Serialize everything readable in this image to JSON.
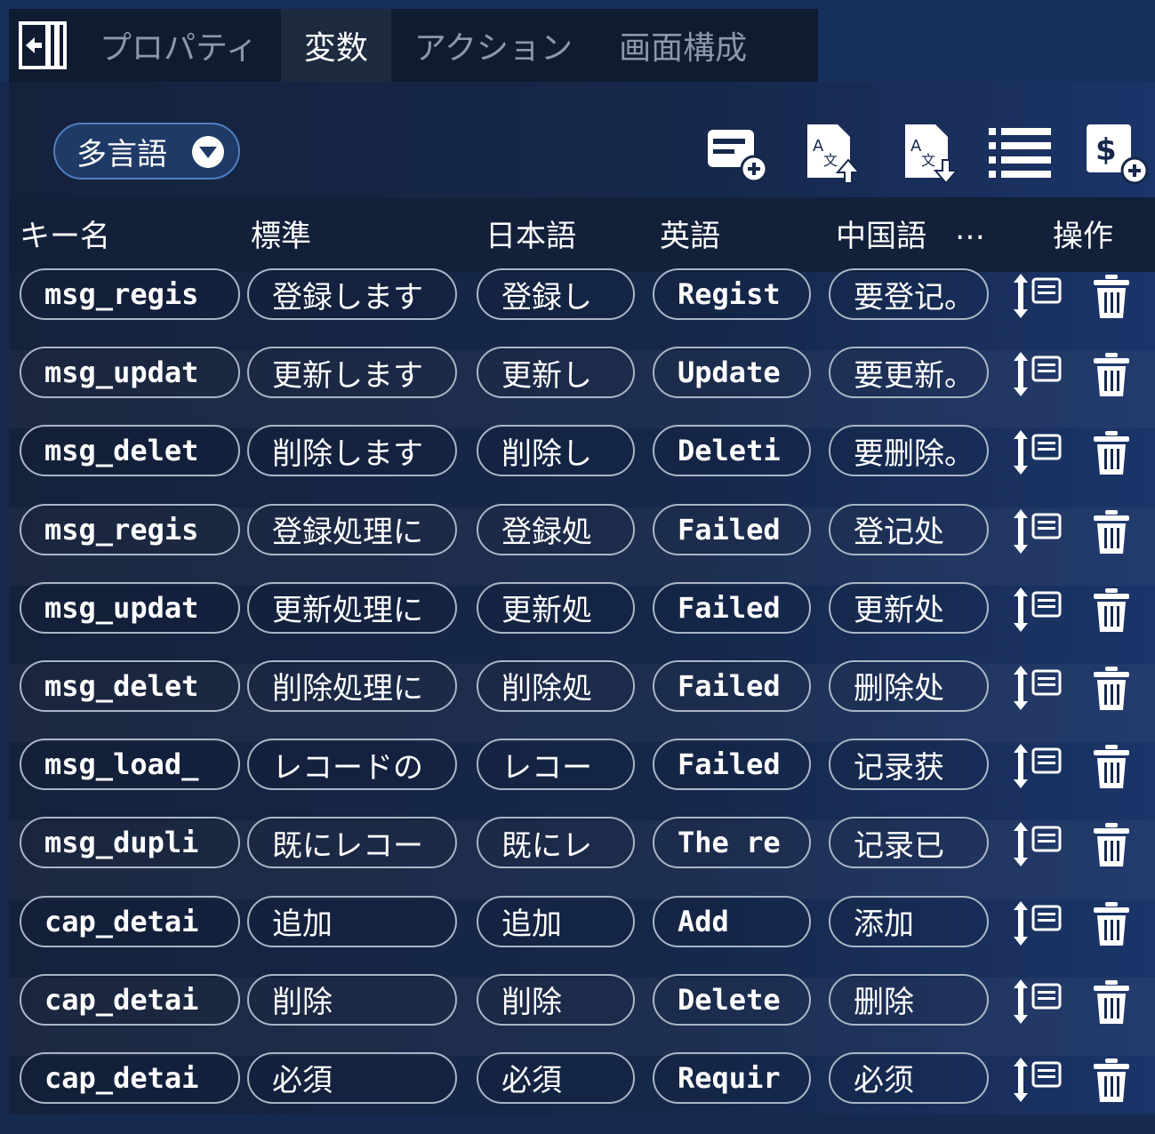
{
  "tabs": [
    {
      "label": "プロパティ",
      "active": false
    },
    {
      "label": "変数",
      "active": true
    },
    {
      "label": "アクション",
      "active": false
    },
    {
      "label": "画面構成",
      "active": false
    }
  ],
  "toolbar": {
    "language_select": "多言語",
    "icons": [
      "add-card-icon",
      "translate-upload-icon",
      "translate-download-icon",
      "list-icon",
      "add-variable-icon"
    ]
  },
  "table": {
    "headers": {
      "key": "キー名",
      "standard": "標準",
      "japanese": "日本語",
      "english": "英語",
      "chinese": "中国語",
      "more": "…",
      "actions": "操作"
    },
    "rows": [
      {
        "key": "msg_regis",
        "standard": "登録します",
        "japanese": "登録し",
        "english": "Regist",
        "chinese": "要登记。"
      },
      {
        "key": "msg_updat",
        "standard": "更新します",
        "japanese": "更新し",
        "english": "Update",
        "chinese": "要更新。"
      },
      {
        "key": "msg_delet",
        "standard": "削除します",
        "japanese": "削除し",
        "english": "Deleti",
        "chinese": "要删除。"
      },
      {
        "key": "msg_regis",
        "standard": "登録処理に",
        "japanese": "登録処",
        "english": "Failed",
        "chinese": "登记处"
      },
      {
        "key": "msg_updat",
        "standard": "更新処理に",
        "japanese": "更新処",
        "english": "Failed",
        "chinese": "更新处"
      },
      {
        "key": "msg_delet",
        "standard": "削除処理に",
        "japanese": "削除処",
        "english": "Failed",
        "chinese": "删除处"
      },
      {
        "key": "msg_load_",
        "standard": "レコードの",
        "japanese": "レコー",
        "english": "Failed",
        "chinese": "记录获"
      },
      {
        "key": "msg_dupli",
        "standard": "既にレコー",
        "japanese": "既にレ",
        "english": "The re",
        "chinese": "记录已"
      },
      {
        "key": "cap_detai",
        "standard": "追加",
        "japanese": "追加",
        "english": "Add",
        "chinese": "添加"
      },
      {
        "key": "cap_detai",
        "standard": "削除",
        "japanese": "削除",
        "english": "Delete",
        "chinese": "删除"
      },
      {
        "key": "cap_detai",
        "standard": "必須",
        "japanese": "必須",
        "english": "Requir",
        "chinese": "必须"
      }
    ]
  }
}
